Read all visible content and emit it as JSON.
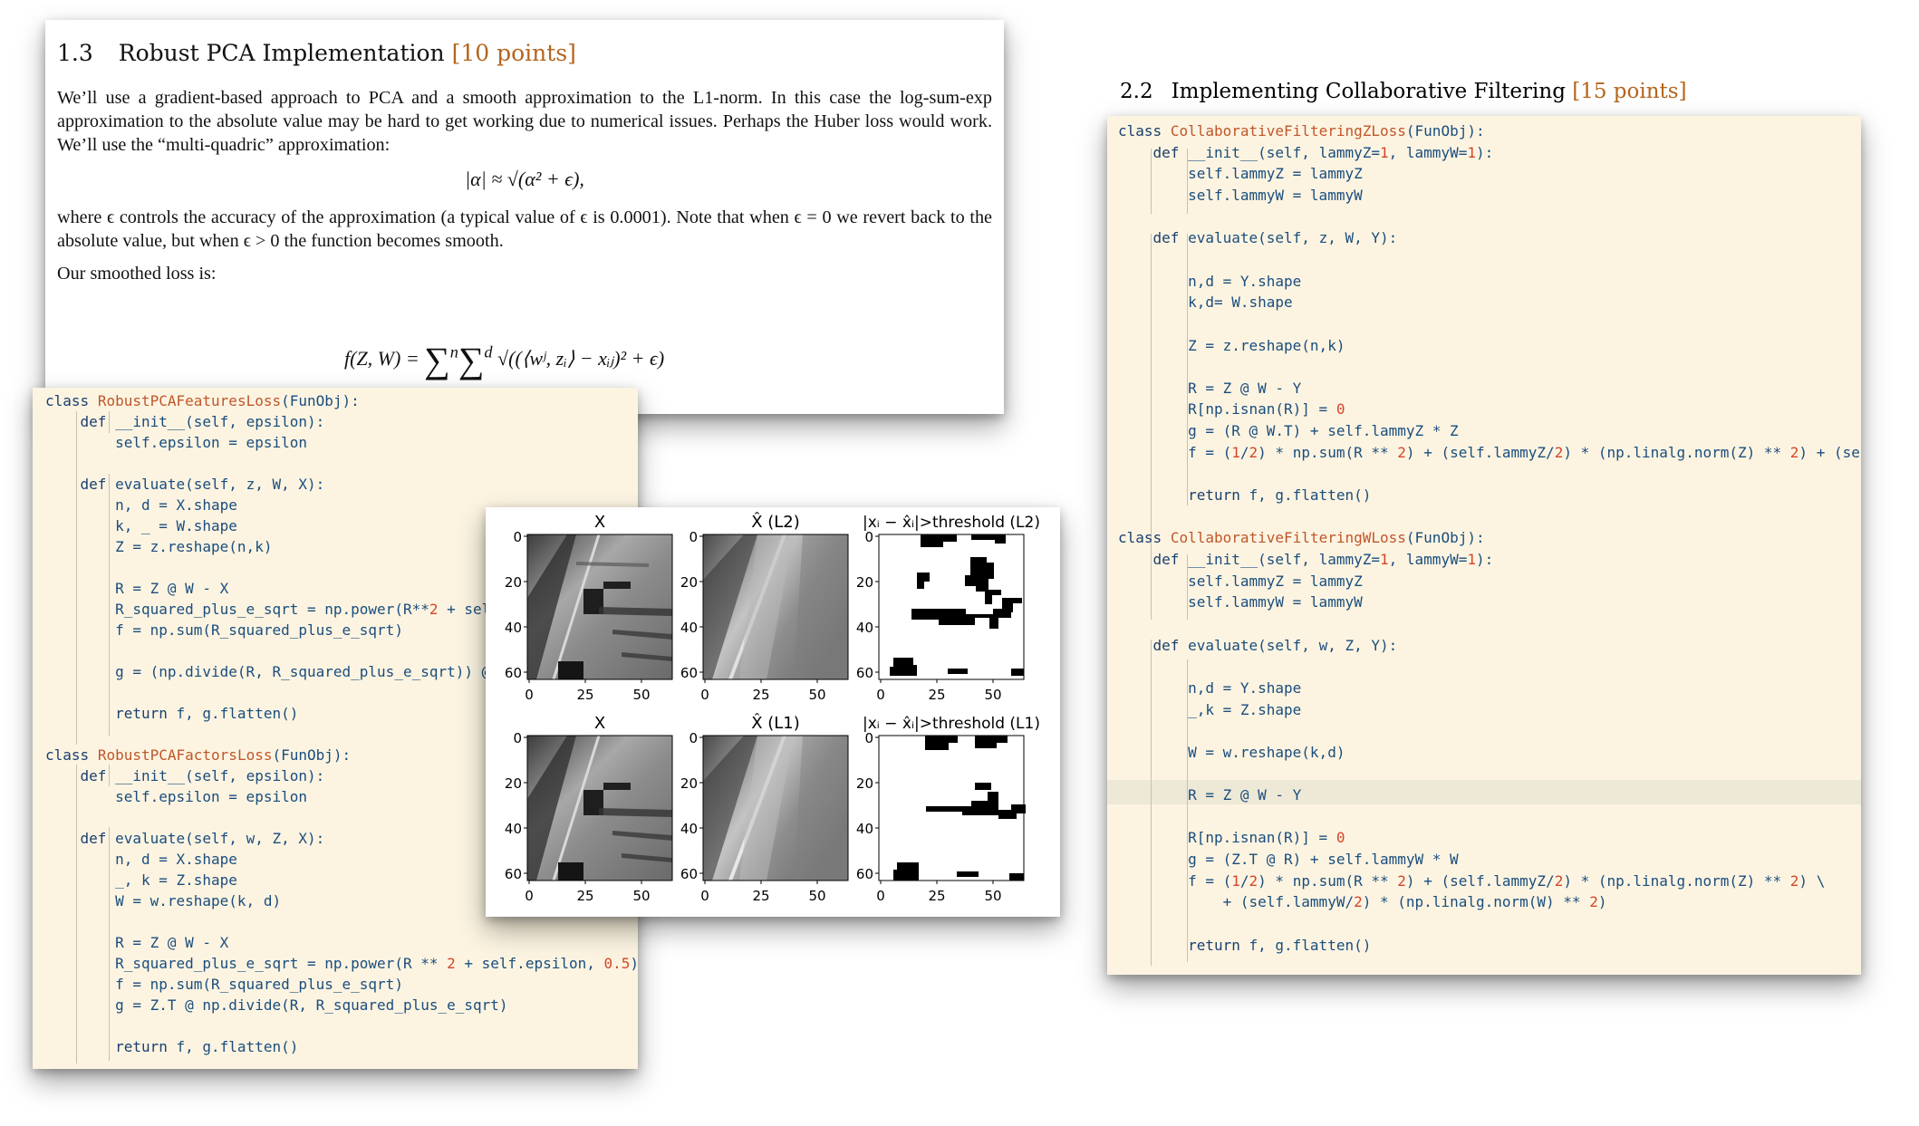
{
  "doc_pca": {
    "section_number": "1.3",
    "section_title": "Robust PCA Implementation",
    "section_points": "[10 points]",
    "paragraph1": "We’ll use a gradient-based approach to PCA and a smooth approximation to the L1-norm. In this case the log-sum-exp approximation to the absolute value may be hard to get working due to numerical issues. Perhaps the Huber loss would work. We’ll use the “multi-quadric” approximation:",
    "equation1": "|α| ≈ √(α² + ϵ),",
    "paragraph2": "where ϵ controls the accuracy of the approximation (a typical value of ϵ is 0.0001). Note that when ϵ = 0 we revert back to the absolute value, but when ϵ > 0 the function becomes smooth.",
    "paragraph3": "Our smoothed loss is:",
    "equation2_lhs": "f(Z, W) = ",
    "equation2_rhs": "√((⟨wʲ, zᵢ⟩ − xᵢⱼ)² + ϵ)",
    "equation2_n": "n",
    "equation2_d": "d"
  },
  "code_pca": {
    "lines": [
      "class RobustPCAFeaturesLoss(FunObj):",
      "    def __init__(self, epsilon):",
      "        self.epsilon = epsilon",
      "",
      "    def evaluate(self, z, W, X):",
      "        n, d = X.shape",
      "        k, _ = W.shape",
      "        Z = z.reshape(n,k)",
      "",
      "        R = Z @ W - X",
      "        R_squared_plus_e_sqrt = np.power(R**2 + self",
      "        f = np.sum(R_squared_plus_e_sqrt)",
      "",
      "        g = (np.divide(R, R_squared_plus_e_sqrt)) @ W",
      "",
      "        return f, g.flatten()",
      "",
      "class RobustPCAFactorsLoss(FunObj):",
      "    def __init__(self, epsilon):",
      "        self.epsilon = epsilon",
      "",
      "    def evaluate(self, w, Z, X):",
      "        n, d = X.shape",
      "        _, k = Z.shape",
      "        W = w.reshape(k, d)",
      "",
      "        R = Z @ W - X",
      "        R_squared_plus_e_sqrt = np.power(R ** 2 + self.epsilon, 0.5)",
      "        f = np.sum(R_squared_plus_e_sqrt)",
      "        g = Z.T @ np.divide(R, R_squared_plus_e_sqrt)",
      "",
      "        return f, g.flatten()"
    ]
  },
  "cf_title": {
    "section_number": "2.2",
    "section_title": "Implementing Collaborative Filtering",
    "section_points": "[15 points]"
  },
  "code_cf": {
    "lines": [
      "class CollaborativeFilteringZLoss(FunObj):",
      "    def __init__(self, lammyZ=1, lammyW=1):",
      "        self.lammyZ = lammyZ",
      "        self.lammyW = lammyW",
      "",
      "    def evaluate(self, z, W, Y):",
      "",
      "        n,d = Y.shape",
      "        k,d= W.shape",
      "",
      "        Z = z.reshape(n,k)",
      "",
      "        R = Z @ W - Y",
      "        R[np.isnan(R)] = 0",
      "        g = (R @ W.T) + self.lammyZ * Z",
      "        f = (1/2) * np.sum(R ** 2) + (self.lammyZ/2) * (np.linalg.norm(Z) ** 2) + (sel",
      "",
      "        return f, g.flatten()",
      "",
      "class CollaborativeFilteringWLoss(FunObj):",
      "    def __init__(self, lammyZ=1, lammyW=1):",
      "        self.lammyZ = lammyZ",
      "        self.lammyW = lammyW",
      "",
      "    def evaluate(self, w, Z, Y):",
      "",
      "        n,d = Y.shape",
      "        _,k = Z.shape",
      "",
      "        W = w.reshape(k,d)",
      "",
      "        R = Z @ W - Y",
      "",
      "        R[np.isnan(R)] = 0",
      "        g = (Z.T @ R) + self.lammyW * W",
      "        f = (1/2) * np.sum(R ** 2) + (self.lammyZ/2) * (np.linalg.norm(Z) ** 2) \\",
      "            + (self.lammyW/2) * (np.linalg.norm(W) ** 2)",
      "",
      "        return f, g.flatten()"
    ]
  },
  "figure": {
    "titles": [
      "X",
      "X̂ (L2)",
      "|xᵢ − x̂ᵢ|>threshold (L2)",
      "X",
      "X̂ (L1)",
      "|xᵢ − x̂ᵢ|>threshold (L1)"
    ],
    "yticks": [
      "0",
      "20",
      "40",
      "60"
    ],
    "xticks": [
      "0",
      "25",
      "50"
    ]
  }
}
